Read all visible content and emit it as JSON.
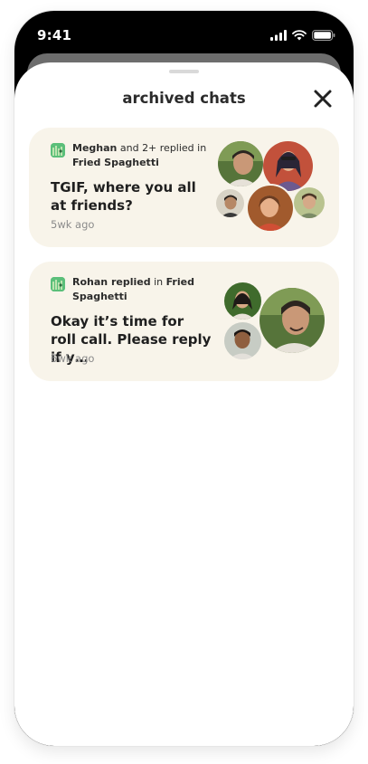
{
  "status": {
    "time": "9:41"
  },
  "sheet": {
    "title": "archived chats"
  },
  "chats": [
    {
      "replier": "Meghan",
      "replied_text": " and 2+ replied in",
      "group": "Fried Spaghetti",
      "message": "TGIF, where you all at friends?",
      "time": "5wk ago"
    },
    {
      "replier": "Rohan replied",
      "replied_text": " in ",
      "group_inline": "Fried",
      "group_rest": "Spaghetti",
      "message": "Okay it’s time for roll call. Please reply if y…",
      "time": "6wk ago"
    }
  ],
  "colors": {
    "card_bg": "#f8f4ea",
    "group_icon": "#5bbf7a",
    "text_primary": "#1f1f1f",
    "text_muted": "#8b8b8b"
  }
}
